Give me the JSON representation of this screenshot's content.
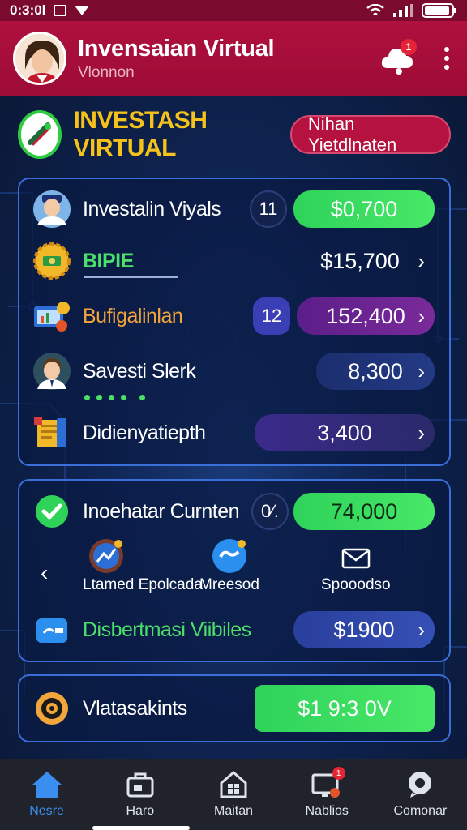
{
  "status_bar": {
    "time": "0:3:0l",
    "colors": {
      "bg": "#7a0a2e"
    }
  },
  "app_bar": {
    "title": "Invensaian Virtual",
    "subtitle": "Vlonnon",
    "notification_count": "1",
    "icons": [
      "avatar",
      "notification-cloud-icon",
      "more-vert-icon"
    ]
  },
  "section": {
    "title": "INVESTASH VIRTUAL",
    "action_label": "Nihan Yietdlnaten"
  },
  "card1": {
    "rows": [
      {
        "label": "Investalin Viyals",
        "chip": "11",
        "value": "$0,700",
        "icon": "person-icon"
      },
      {
        "label": "BIPIE",
        "value": "$15,700",
        "icon": "gear-coin-icon"
      },
      {
        "label": "Bufigalinlan",
        "chip": "12",
        "value": "152,400",
        "icon": "chart-icon"
      },
      {
        "label": "Savesti Slerk",
        "value": "8,300",
        "icon": "person-icon"
      },
      {
        "label": "Didienyatiepth",
        "value": "3,400",
        "icon": "notebook-icon"
      }
    ]
  },
  "card2": {
    "header": {
      "label": "Inoehatar Curnten",
      "chip": "0⁄.",
      "value": "74,000"
    },
    "links": [
      {
        "label": "Ltamed Epolcada",
        "icon": "chart-badge-icon"
      },
      {
        "label": "Mreesod",
        "icon": "link-badge-icon"
      },
      {
        "label": "Spooodso",
        "icon": "mail-icon"
      }
    ],
    "footer": {
      "label": "Disbertmasi Viibiles",
      "value": "$1900"
    }
  },
  "card3": {
    "label": "Vlatasakints",
    "value": "$1 9:3 0V",
    "icon": "target-icon"
  },
  "bottom_nav": [
    {
      "label": "Nesre",
      "icon": "home-icon",
      "active": true
    },
    {
      "label": "Haro",
      "icon": "briefcase-icon",
      "active": false
    },
    {
      "label": "Maitan",
      "icon": "house-grid-icon",
      "active": false
    },
    {
      "label": "Nablios",
      "icon": "monitor-icon",
      "active": false,
      "badge": "1"
    },
    {
      "label": "Comonar",
      "icon": "chat-icon",
      "active": false
    }
  ],
  "colors": {
    "accent": "#b0103e",
    "gold": "#f4c21a",
    "green": "#2fd35a",
    "card_border": "#3a6ed8"
  }
}
